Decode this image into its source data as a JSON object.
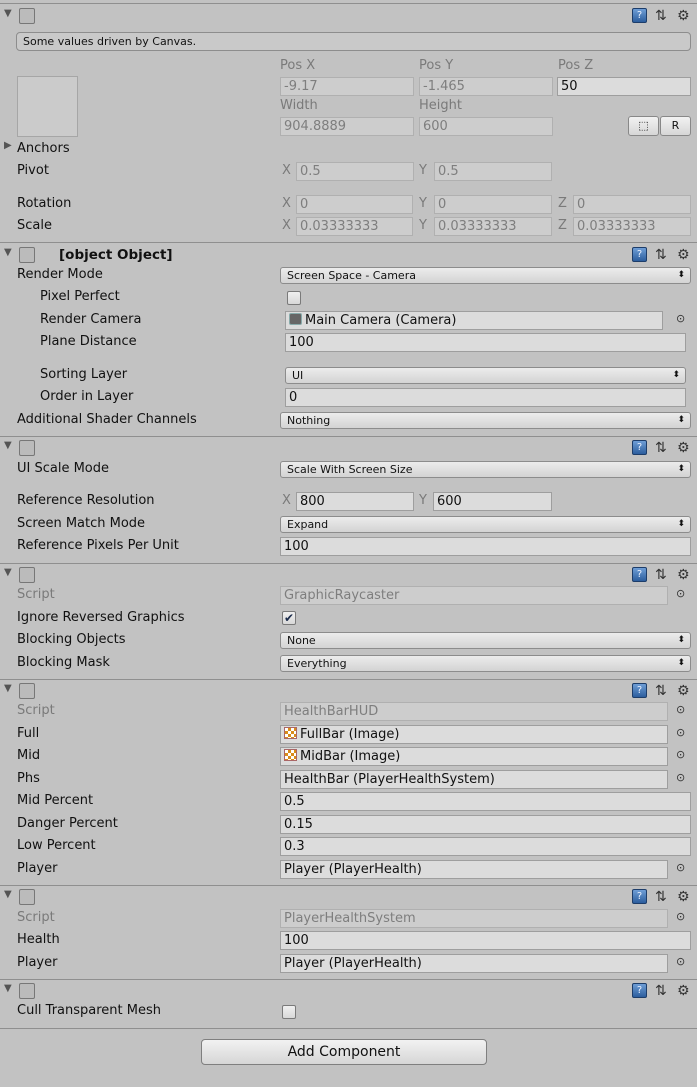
{
  "common": {
    "x": "X",
    "y": "Y",
    "z": "Z"
  },
  "rect_transform": {
    "title": "Rect Transform",
    "info": "Some values driven by Canvas.",
    "pos_x_label": "Pos X",
    "pos_y_label": "Pos Y",
    "pos_z_label": "Pos Z",
    "pos_x": "-9.17",
    "pos_y": "-1.465",
    "pos_z": "50",
    "width_label": "Width",
    "height_label": "Height",
    "width": "904.8889",
    "height": "600",
    "raw_edit_button": "⬚",
    "reset_button": "R",
    "anchors": "Anchors",
    "pivot": "Pivot",
    "pivot_x": "0.5",
    "pivot_y": "0.5",
    "rotation": "Rotation",
    "rotation_x": "0",
    "rotation_y": "0",
    "rotation_z": "0",
    "scale": "Scale",
    "scale_x": "0.03333333",
    "scale_y": "0.03333333",
    "scale_z": "0.03333333"
  },
  "canvas": {
    "title": "Canvas",
    "enabled": true,
    "render_mode_label": "Render Mode",
    "render_mode": "Screen Space - Camera",
    "pixel_perfect_label": "Pixel Perfect",
    "pixel_perfect": false,
    "render_camera_label": "Render Camera",
    "render_camera": "Main Camera (Camera)",
    "plane_distance_label": "Plane Distance",
    "plane_distance": "100",
    "sorting_layer_label": "Sorting Layer",
    "sorting_layer": "UI",
    "order_in_layer_label": "Order in Layer",
    "order_in_layer": "0",
    "shader_channels_label": "Additional Shader Channels",
    "shader_channels": "Nothing"
  },
  "canvas_scaler": {
    "title": "Canvas Scaler (Script)",
    "enabled": true,
    "ui_scale_mode_label": "UI Scale Mode",
    "ui_scale_mode": "Scale With Screen Size",
    "ref_resolution_label": "Reference Resolution",
    "ref_x": "800",
    "ref_y": "600",
    "screen_match_mode_label": "Screen Match Mode",
    "screen_match_mode": "Expand",
    "ref_ppu_label": "Reference Pixels Per Unit",
    "ref_ppu": "100"
  },
  "graphic_raycaster": {
    "title": "Graphic Raycaster (Script)",
    "enabled": true,
    "script_label": "Script",
    "script": "GraphicRaycaster",
    "ignore_reversed_label": "Ignore Reversed Graphics",
    "ignore_reversed": true,
    "blocking_objects_label": "Blocking Objects",
    "blocking_objects": "None",
    "blocking_mask_label": "Blocking Mask",
    "blocking_mask": "Everything"
  },
  "health_bar_hud": {
    "title": "Health Bar HUD (Script)",
    "enabled": true,
    "script_label": "Script",
    "script": "HealthBarHUD",
    "full_label": "Full",
    "full": "FullBar (Image)",
    "mid_label": "Mid",
    "mid": "MidBar (Image)",
    "phs_label": "Phs",
    "phs": "HealthBar (PlayerHealthSystem)",
    "mid_percent_label": "Mid Percent",
    "mid_percent": "0.5",
    "danger_percent_label": "Danger Percent",
    "danger_percent": "0.15",
    "low_percent_label": "Low Percent",
    "low_percent": "0.3",
    "player_label": "Player",
    "player": "Player (PlayerHealth)"
  },
  "player_health_system": {
    "title": "Player Health System (Script)",
    "enabled": true,
    "script_label": "Script",
    "script": "PlayerHealthSystem",
    "health_label": "Health",
    "health": "100",
    "player_label": "Player",
    "player": "Player (PlayerHealth)"
  },
  "canvas_renderer": {
    "title": "Canvas Renderer",
    "cull_label": "Cull Transparent Mesh",
    "cull": false
  },
  "add_component_button": "Add Component",
  "icons": {
    "help": "help-icon",
    "presets": "presets-icon",
    "settings": "gear-icon",
    "picker": "object-picker-icon"
  }
}
